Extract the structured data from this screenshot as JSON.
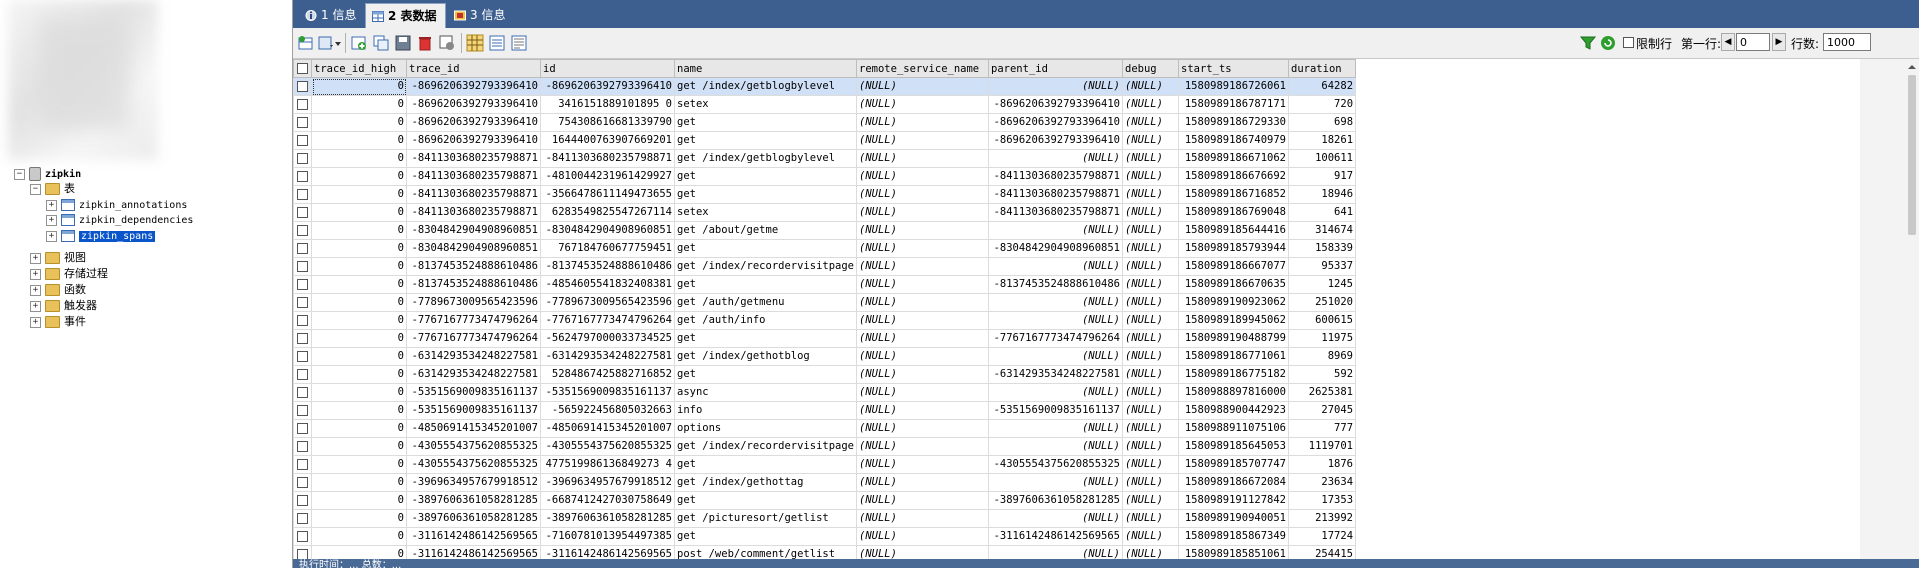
{
  "tree": {
    "db_name": "zipkin",
    "tables_folder": "表",
    "tables": [
      "zipkin_annotations",
      "zipkin_dependencies",
      "zipkin_spans"
    ],
    "folders": [
      "视图",
      "存储过程",
      "函数",
      "触发器",
      "事件"
    ]
  },
  "tabs": [
    {
      "label": "1 信息"
    },
    {
      "label": "2 表数据"
    },
    {
      "label": "3 信息"
    }
  ],
  "toolbar": {
    "limit_label": "限制行",
    "first_row_label": "第一行:",
    "first_row_value": "0",
    "rows_label": "行数:",
    "rows_value": "1000"
  },
  "grid": {
    "columns": [
      "trace_id_high",
      "trace_id",
      "id",
      "name",
      "remote_service_name",
      "parent_id",
      "debug",
      "start_ts",
      "duration"
    ],
    "rows": [
      [
        "0",
        "-8696206392793396410",
        "-8696206392793396410",
        "get /index/getblogbylevel",
        "(NULL)",
        "(NULL)",
        "(NULL)",
        "1580989186726061",
        "64282"
      ],
      [
        "0",
        "-8696206392793396410",
        "3416151889101895 0",
        "setex",
        "(NULL)",
        "-8696206392793396410",
        "(NULL)",
        "1580989186787171",
        "720"
      ],
      [
        "0",
        "-8696206392793396410",
        "754308616681339790",
        "get",
        "(NULL)",
        "-8696206392793396410",
        "(NULL)",
        "1580989186729330",
        "698"
      ],
      [
        "0",
        "-8696206392793396410",
        "1644400763907669201",
        "get",
        "(NULL)",
        "-8696206392793396410",
        "(NULL)",
        "1580989186740979",
        "18261"
      ],
      [
        "0",
        "-8411303680235798871",
        "-8411303680235798871",
        "get /index/getblogbylevel",
        "(NULL)",
        "(NULL)",
        "(NULL)",
        "1580989186671062",
        "100611"
      ],
      [
        "0",
        "-8411303680235798871",
        "-4810044231961429927",
        "get",
        "(NULL)",
        "-8411303680235798871",
        "(NULL)",
        "1580989186676692",
        "917"
      ],
      [
        "0",
        "-8411303680235798871",
        "-3566478611149473655",
        "get",
        "(NULL)",
        "-8411303680235798871",
        "(NULL)",
        "1580989186716852",
        "18946"
      ],
      [
        "0",
        "-8411303680235798871",
        "6283549825547267114",
        "setex",
        "(NULL)",
        "-8411303680235798871",
        "(NULL)",
        "1580989186769048",
        "641"
      ],
      [
        "0",
        "-8304842904908960851",
        "-8304842904908960851",
        "get /about/getme",
        "(NULL)",
        "(NULL)",
        "(NULL)",
        "1580989185644416",
        "314674"
      ],
      [
        "0",
        "-8304842904908960851",
        "767184760677759451",
        "get",
        "(NULL)",
        "-8304842904908960851",
        "(NULL)",
        "1580989185793944",
        "158339"
      ],
      [
        "0",
        "-8137453524888610486",
        "-8137453524888610486",
        "get /index/recordervisitpage",
        "(NULL)",
        "(NULL)",
        "(NULL)",
        "1580989186667077",
        "95337"
      ],
      [
        "0",
        "-8137453524888610486",
        "-4854605541832408381",
        "get",
        "(NULL)",
        "-8137453524888610486",
        "(NULL)",
        "1580989186670635",
        "1245"
      ],
      [
        "0",
        "-7789673009565423596",
        "-7789673009565423596",
        "get /auth/getmenu",
        "(NULL)",
        "(NULL)",
        "(NULL)",
        "1580989190923062",
        "251020"
      ],
      [
        "0",
        "-7767167773474796264",
        "-7767167773474796264",
        "get /auth/info",
        "(NULL)",
        "(NULL)",
        "(NULL)",
        "1580989189945062",
        "600615"
      ],
      [
        "0",
        "-7767167773474796264",
        "-5624797000033734525",
        "get",
        "(NULL)",
        "-7767167773474796264",
        "(NULL)",
        "1580989190488799",
        "11975"
      ],
      [
        "0",
        "-6314293534248227581",
        "-6314293534248227581",
        "get /index/gethotblog",
        "(NULL)",
        "(NULL)",
        "(NULL)",
        "1580989186771061",
        "8969"
      ],
      [
        "0",
        "-6314293534248227581",
        "5284867425882716852",
        "get",
        "(NULL)",
        "-6314293534248227581",
        "(NULL)",
        "1580989186775182",
        "592"
      ],
      [
        "0",
        "-5351569009835161137",
        "-5351569009835161137",
        "async",
        "(NULL)",
        "(NULL)",
        "(NULL)",
        "1580988897816000",
        "2625381"
      ],
      [
        "0",
        "-5351569009835161137",
        "-565922456805032663",
        "info",
        "(NULL)",
        "-5351569009835161137",
        "(NULL)",
        "1580988900442923",
        "27045"
      ],
      [
        "0",
        "-4850691415345201007",
        "-4850691415345201007",
        "options",
        "(NULL)",
        "(NULL)",
        "(NULL)",
        "1580988911075106",
        "777"
      ],
      [
        "0",
        "-4305554375620855325",
        "-4305554375620855325",
        "get /index/recordervisitpage",
        "(NULL)",
        "(NULL)",
        "(NULL)",
        "1580989185645053",
        "1119701"
      ],
      [
        "0",
        "-4305554375620855325",
        "477519986136849273 4",
        "get",
        "(NULL)",
        "-4305554375620855325",
        "(NULL)",
        "1580989185707747",
        "1876"
      ],
      [
        "0",
        "-3969634957679918512",
        "-3969634957679918512",
        "get /index/gethottag",
        "(NULL)",
        "(NULL)",
        "(NULL)",
        "1580989186672084",
        "23634"
      ],
      [
        "0",
        "-3897606361058281285",
        "-6687412427030758649",
        "get",
        "(NULL)",
        "-3897606361058281285",
        "(NULL)",
        "1580989191127842",
        "17353"
      ],
      [
        "0",
        "-3897606361058281285",
        "-3897606361058281285",
        "get /picturesort/getlist",
        "(NULL)",
        "(NULL)",
        "(NULL)",
        "1580989190940051",
        "213992"
      ],
      [
        "0",
        "-3116142486142569565",
        "-7160781013954497385",
        "get",
        "(NULL)",
        "-3116142486142569565",
        "(NULL)",
        "1580989185867349",
        "17724"
      ],
      [
        "0",
        "-3116142486142569565",
        "-3116142486142569565",
        "post /web/comment/getlist",
        "(NULL)",
        "(NULL)",
        "(NULL)",
        "1580989185851061",
        "254415"
      ]
    ]
  },
  "status_text": "执行时间：... 总数：..."
}
